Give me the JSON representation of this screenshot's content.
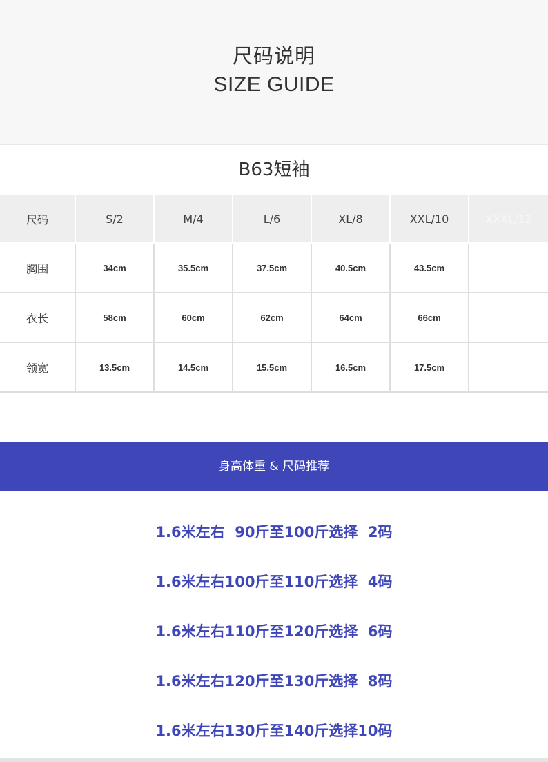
{
  "header": {
    "title_cn": "尺码说明",
    "title_en": "SIZE GUIDE"
  },
  "product": {
    "name": "B63短袖"
  },
  "size_table": {
    "corner_label": "尺码",
    "sizes": [
      "S/2",
      "M/4",
      "L/6",
      "XL/8",
      "XXL/10",
      "XXXL/12"
    ],
    "rows": [
      {
        "label": "胸围",
        "values": [
          "34cm",
          "35.5cm",
          "37.5cm",
          "40.5cm",
          "43.5cm",
          ""
        ]
      },
      {
        "label": "衣长",
        "values": [
          "58cm",
          "60cm",
          "62cm",
          "64cm",
          "66cm",
          ""
        ]
      },
      {
        "label": "领宽",
        "values": [
          "13.5cm",
          "14.5cm",
          "15.5cm",
          "16.5cm",
          "17.5cm",
          ""
        ]
      }
    ]
  },
  "recommendation": {
    "banner": "身高体重 & 尺码推荐",
    "items": [
      "1.6米左右  90斤至100斤选择  2码",
      "1.6米左右100斤至110斤选择  4码",
      "1.6米左右110斤至120斤选择  6码",
      "1.6米左右120斤至130斤选择  8码",
      "1.6米左右130斤至140斤选择10码"
    ]
  },
  "colors": {
    "accent": "#3e46b8",
    "header_bg": "#f7f7f7",
    "table_header_bg": "#eeeeee",
    "grid_line": "#dedede"
  }
}
